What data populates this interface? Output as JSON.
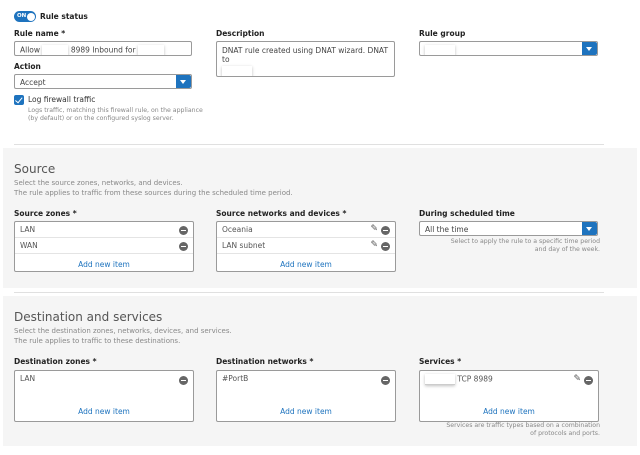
{
  "rule_status": {
    "toggle_text": "ON",
    "label": "Rule status"
  },
  "rule_name": {
    "label": "Rule name *",
    "value_prefix": "Allow",
    "value_suffix": "8989 Inbound for"
  },
  "description": {
    "label": "Description",
    "value": "DNAT rule created using DNAT wizard. DNAT to"
  },
  "rule_group": {
    "label": "Rule group"
  },
  "action": {
    "label": "Action",
    "value": "Accept"
  },
  "log": {
    "label": "Log firewall traffic",
    "hint": "Logs traffic, matching this firewall rule, on the appliance (by default) or on the configured syslog server."
  },
  "source": {
    "title": "Source",
    "desc1": "Select the source zones, networks, and devices.",
    "desc2": "The rule applies to traffic from these sources during the scheduled time period.",
    "zones_label": "Source zones *",
    "zones": [
      "LAN",
      "WAN"
    ],
    "networks_label": "Source networks and devices *",
    "networks": [
      "Oceania",
      "LAN subnet"
    ],
    "schedule_label": "During scheduled time",
    "schedule_value": "All the time",
    "schedule_hint": "Select to apply the rule to a specific time period and day of the week."
  },
  "destination": {
    "title": "Destination and services",
    "desc1": "Select the destination zones, networks, devices, and services.",
    "desc2": "The rule applies to traffic to these destinations.",
    "zones_label": "Destination zones *",
    "zones": [
      "LAN"
    ],
    "networks_label": "Destination networks *",
    "networks": [
      "#PortB"
    ],
    "services_label": "Services *",
    "services": [
      "TCP 8989"
    ],
    "services_hint": "Services are traffic types based on a combination of protocols and ports."
  },
  "add_new_item": "Add new item",
  "colors": {
    "accent": "#1e73be",
    "section_bg": "#f5f5f5"
  }
}
